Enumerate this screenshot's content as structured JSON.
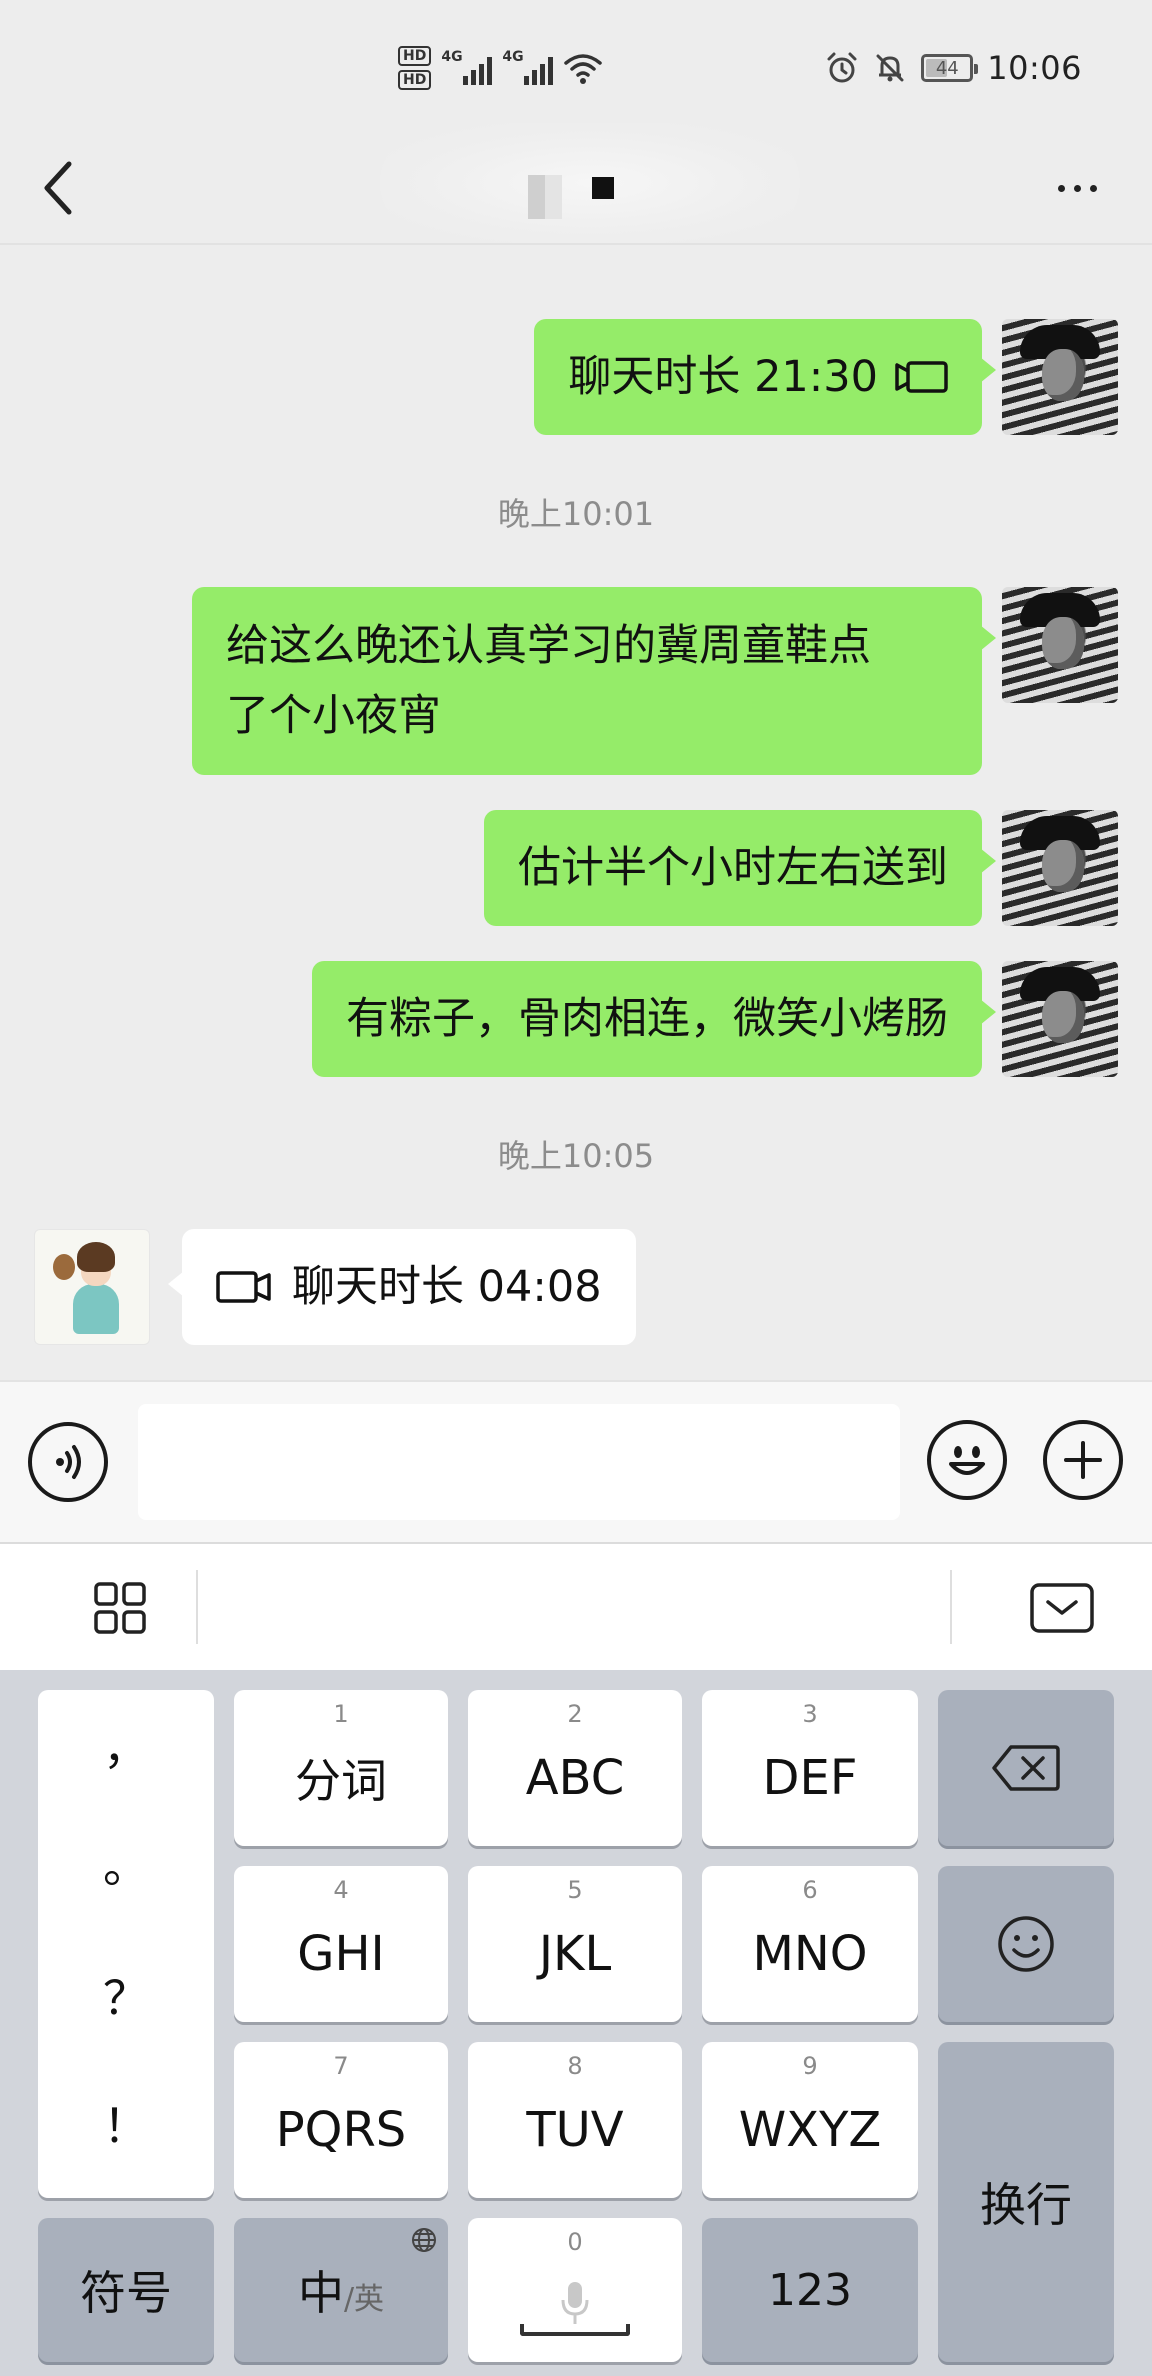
{
  "status_bar": {
    "hd_labels": [
      "HD",
      "HD"
    ],
    "sim_labels": [
      "4G",
      "4G"
    ],
    "battery_percent": 44,
    "battery_label": "44",
    "time": "10:06",
    "icons": [
      "signal-icon",
      "wifi-icon",
      "alarm-icon",
      "mute-icon",
      "battery-icon"
    ]
  },
  "header": {
    "title": "",
    "back_icon": "chevron-left-icon",
    "more_icon": "more-dots-icon"
  },
  "messages": [
    {
      "from": "me",
      "type": "call",
      "text": "聊天时长 21:30",
      "icon": "video-call-icon"
    },
    {
      "type": "timestamp",
      "text": "晚上10:01"
    },
    {
      "from": "me",
      "type": "text",
      "text": "给这么晚还认真学习的冀周童鞋点\n了个小夜宵"
    },
    {
      "from": "me",
      "type": "text",
      "text": "估计半个小时左右送到"
    },
    {
      "from": "me",
      "type": "text",
      "text": "有粽子，骨肉相连，微笑小烤肠"
    },
    {
      "type": "timestamp",
      "text": "晚上10:05"
    },
    {
      "from": "them",
      "type": "call",
      "text": "聊天时长 04:08",
      "icon": "video-call-icon"
    }
  ],
  "input_bar": {
    "voice_icon": "voice-icon",
    "input_value": "",
    "emoji_icon": "emoji-icon",
    "plus_icon": "plus-icon"
  },
  "keyboard_toolbar": {
    "left_icon": "grid-menu-icon",
    "right_icon": "keyboard-collapse-icon"
  },
  "keyboard": {
    "punctuation": [
      "，",
      "。",
      "？",
      "！"
    ],
    "keys": [
      {
        "num": "1",
        "label": "分词"
      },
      {
        "num": "2",
        "label": "ABC"
      },
      {
        "num": "3",
        "label": "DEF"
      },
      {
        "num": "4",
        "label": "GHI"
      },
      {
        "num": "5",
        "label": "JKL"
      },
      {
        "num": "6",
        "label": "MNO"
      },
      {
        "num": "7",
        "label": "PQRS"
      },
      {
        "num": "8",
        "label": "TUV"
      },
      {
        "num": "9",
        "label": "WXYZ"
      }
    ],
    "backspace_icon": "backspace-icon",
    "emoji_key_icon": "smiley-icon",
    "enter_label": "换行",
    "symbols_label": "符号",
    "lang_main": "中",
    "lang_sub": "/英",
    "space_num": "0",
    "num_label": "123"
  }
}
